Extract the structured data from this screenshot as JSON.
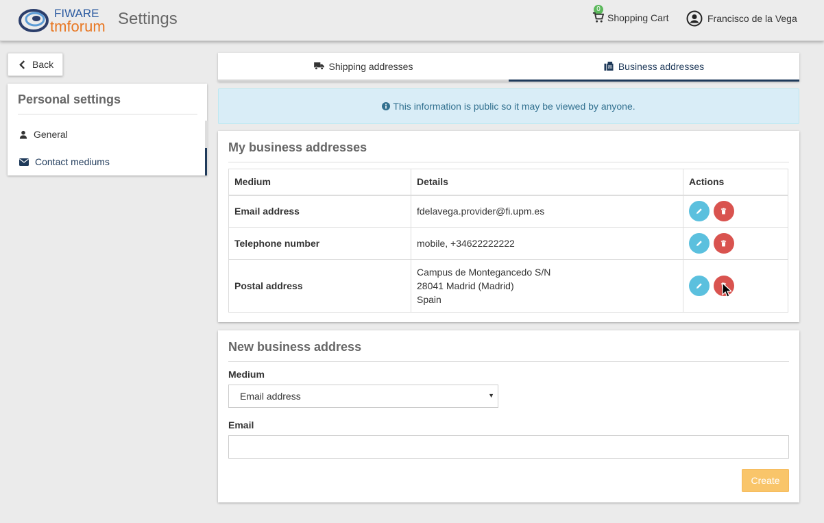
{
  "header": {
    "logo_top": "FIWARE",
    "logo_bottom": "tmforum",
    "title": "Settings",
    "cart_count": "0",
    "cart_label": "Shopping Cart",
    "user_name": "Francisco de la Vega"
  },
  "sidebar": {
    "back_label": "Back",
    "title": "Personal settings",
    "items": [
      {
        "label": "General",
        "icon": "user-icon"
      },
      {
        "label": "Contact mediums",
        "icon": "envelope-icon",
        "active": true
      }
    ]
  },
  "tabs": [
    {
      "label": "Shipping addresses",
      "icon": "truck-icon"
    },
    {
      "label": "Business addresses",
      "icon": "fax-icon",
      "active": true
    }
  ],
  "alert": {
    "text": "This information is public so it may be viewed by anyone."
  },
  "list_panel": {
    "title": "My business addresses",
    "columns": [
      "Medium",
      "Details",
      "Actions"
    ],
    "rows": [
      {
        "medium": "Email address",
        "details": [
          "fdelavega.provider@fi.upm.es"
        ]
      },
      {
        "medium": "Telephone number",
        "details": [
          "mobile, +34622222222"
        ]
      },
      {
        "medium": "Postal address",
        "details": [
          "Campus de Montegancedo S/N",
          "28041 Madrid (Madrid)",
          "Spain"
        ]
      }
    ]
  },
  "create_panel": {
    "title": "New business address",
    "medium_label": "Medium",
    "medium_value": "Email address",
    "email_label": "Email",
    "email_value": "",
    "create_label": "Create"
  },
  "colors": {
    "accent": "#1f3a5a",
    "info_bg": "#d9edf7",
    "edit": "#5bc0de",
    "delete": "#d9534f",
    "create": "#f9c56a"
  }
}
